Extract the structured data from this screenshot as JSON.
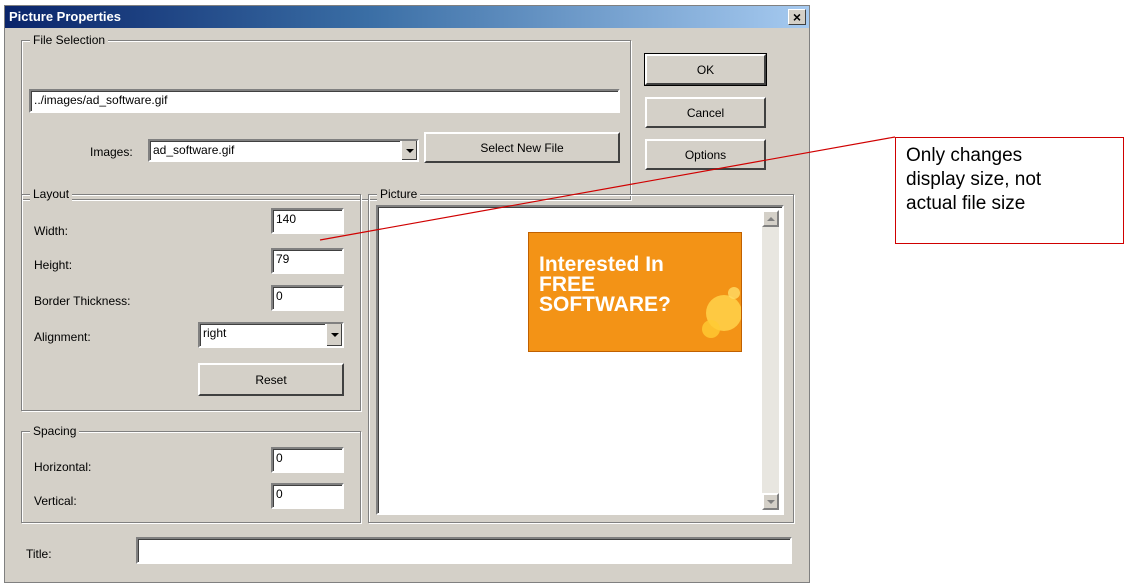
{
  "window": {
    "title": "Picture Properties",
    "close_glyph": "×"
  },
  "file_selection": {
    "legend": "File Selection",
    "path_value": "../images/ad_software.gif",
    "images_label": "Images:",
    "images_selected": "ad_software.gif",
    "select_button": "Select New File"
  },
  "buttons": {
    "ok": "OK",
    "cancel": "Cancel",
    "options": "Options"
  },
  "layout": {
    "legend": "Layout",
    "width_label": "Width:",
    "width_value": "140",
    "height_label": "Height:",
    "height_value": "79",
    "border_label": "Border Thickness:",
    "border_value": "0",
    "alignment_label": "Alignment:",
    "alignment_value": "right",
    "reset_button": "Reset"
  },
  "spacing": {
    "legend": "Spacing",
    "horizontal_label": "Horizontal:",
    "horizontal_value": "0",
    "vertical_label": "Vertical:",
    "vertical_value": "0"
  },
  "picture": {
    "legend": "Picture",
    "ad_line1": "Interested In",
    "ad_line2": "FREE",
    "ad_line3": "SOFTWARE?"
  },
  "title_field": {
    "label": "Title:",
    "value": ""
  },
  "callout": {
    "line1": "Only changes",
    "line2": "display size, not",
    "line3": "actual file size"
  },
  "colors": {
    "accent_line": "#d00000",
    "ad_orange": "#f39316",
    "titlebar": "#0a246a"
  }
}
